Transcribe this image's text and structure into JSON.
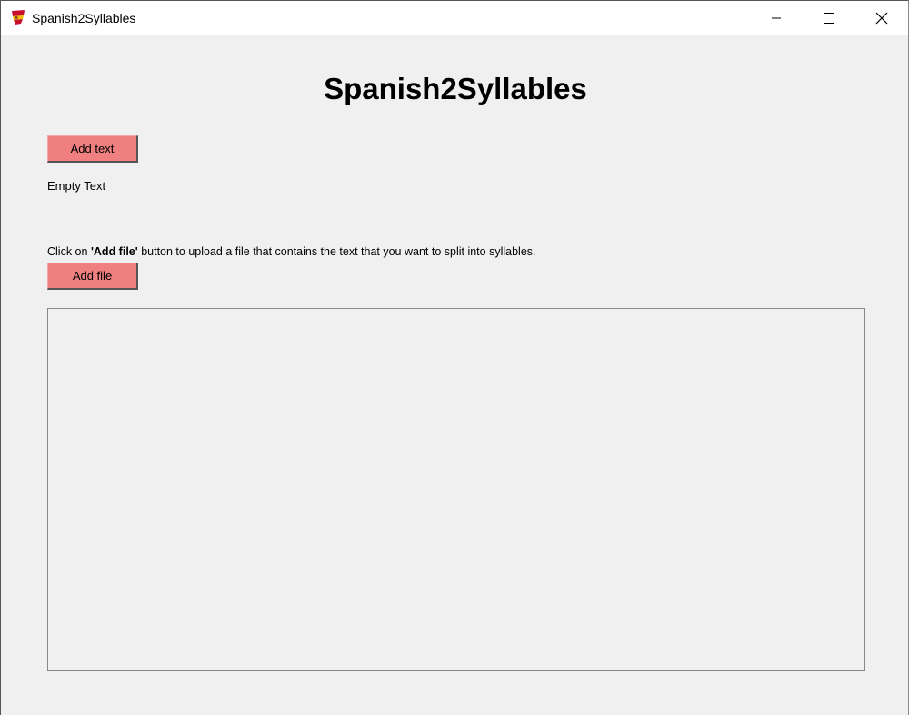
{
  "window": {
    "title": "Spanish2Syllables",
    "icon": "spain-flag-icon",
    "controls": {
      "minimize": "minimize-icon",
      "maximize": "maximize-icon",
      "close": "close-icon"
    }
  },
  "main": {
    "heading": "Spanish2Syllables",
    "add_text_label": "Add text",
    "status_text": "Empty Text",
    "instruction_prefix": "Click on ",
    "instruction_bold": "'Add file'",
    "instruction_suffix": " button to upload a file that contains the text that you want to split into syllables.",
    "add_file_label": "Add file",
    "text_area_value": ""
  },
  "colors": {
    "button_bg": "#f08080",
    "window_bg": "#f0f0f0",
    "titlebar_bg": "#ffffff"
  }
}
